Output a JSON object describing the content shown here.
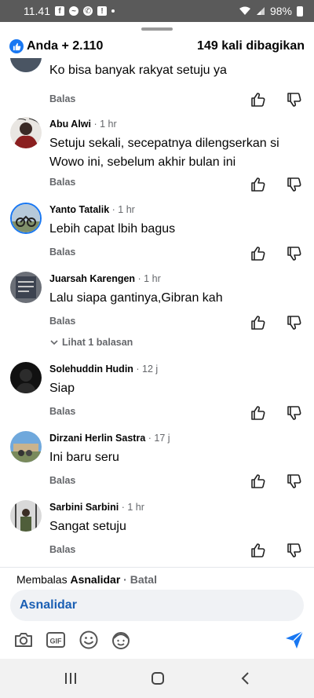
{
  "status_bar": {
    "time": "11.41",
    "battery": "98%",
    "app_icons": [
      "facebook-icon",
      "messenger-icon",
      "whatsapp-icon",
      "notification-app-icon"
    ]
  },
  "reactions": {
    "summary": "Anda + 2.110",
    "shares": "149 kali dibagikan",
    "icon": "like-icon",
    "accent": "#1877f2"
  },
  "comments": [
    {
      "name": "",
      "time": "",
      "text": "Ko bisa banyak rakyat setuju ya",
      "reply_label": "Balas"
    },
    {
      "name": "Abu Alwi",
      "time": " · 1 hr",
      "text": "Setuju sekali, secepatnya dilengserkan si Wowo ini, sebelum akhir bulan ini",
      "reply_label": "Balas"
    },
    {
      "name": "Yanto Tatalik",
      "time": " · 1 hr",
      "text": "Lebih capat lbih bagus",
      "reply_label": "Balas"
    },
    {
      "name": "Juarsah Karengen",
      "time": " · 1 hr",
      "text": "Lalu siapa gantinya,Gibran kah",
      "reply_label": "Balas",
      "view_replies": "Lihat 1 balasan"
    },
    {
      "name": "Solehuddin Hudin",
      "time": " · 12 j",
      "text": "Siap",
      "reply_label": "Balas"
    },
    {
      "name": "Dirzani Herlin Sastra",
      "time": " · 17 j",
      "text": "Ini baru seru",
      "reply_label": "Balas"
    },
    {
      "name": "Sarbini Sarbini",
      "time": " · 1 hr",
      "text": "Sangat setuju",
      "reply_label": "Balas"
    }
  ],
  "reply_bar": {
    "prefix": "Membalas ",
    "target": "Asnalidar",
    "separator": " · ",
    "cancel": "Batal",
    "input_value": "Asnalidar",
    "tools": [
      "camera-icon",
      "gif-icon",
      "emoji-icon",
      "avatar-sticker-icon"
    ],
    "send_icon": "send-icon",
    "send_color": "#1877f2"
  },
  "nav": [
    "recent-apps-icon",
    "home-icon",
    "back-icon"
  ]
}
